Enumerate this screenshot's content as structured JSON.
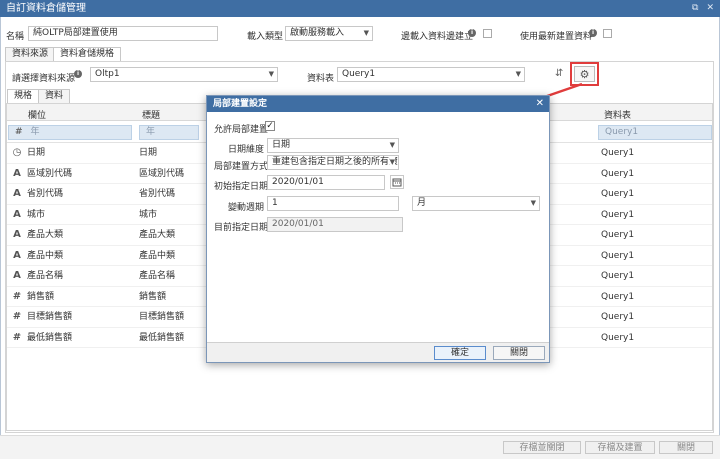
{
  "window": {
    "title": "自訂資料倉儲管理",
    "btn_restore": "⧉",
    "btn_close": "✕"
  },
  "form": {
    "name_label": "名稱",
    "name_value": "純OLTP局部建置使用",
    "load_type_label": "載入類型",
    "load_type_value": "啟動服務載入",
    "rebuild_on_load_label": "邊載入資料邊建立",
    "use_latest_build_label": "使用最新建置資料"
  },
  "top_tabs": [
    "資料來源",
    "資料倉儲規格"
  ],
  "source": {
    "select_source_label": "請選擇資料來源",
    "source_value": "Oltp1",
    "table_label": "資料表",
    "table_value": "Query1"
  },
  "inner_tabs": [
    "規格",
    "資料"
  ],
  "grid": {
    "headers": {
      "field": "欄位",
      "title": "標題",
      "table": "資料表"
    },
    "filter": {
      "field": "年",
      "title": "年",
      "table": "Query1"
    },
    "rows": [
      {
        "icon": "clock",
        "field": "日期",
        "title": "日期",
        "table": "Query1"
      },
      {
        "icon": "text",
        "field": "區域別代碼",
        "title": "區域別代碼",
        "table": "Query1"
      },
      {
        "icon": "text",
        "field": "省別代碼",
        "title": "省別代碼",
        "table": "Query1"
      },
      {
        "icon": "text",
        "field": "城市",
        "title": "城市",
        "table": "Query1"
      },
      {
        "icon": "text",
        "field": "產品大類",
        "title": "產品大類",
        "table": "Query1"
      },
      {
        "icon": "text",
        "field": "產品中類",
        "title": "產品中類",
        "table": "Query1"
      },
      {
        "icon": "text",
        "field": "產品名稱",
        "title": "產品名稱",
        "table": "Query1"
      },
      {
        "icon": "hash",
        "field": "銷售額",
        "title": "銷售額",
        "table": "Query1"
      },
      {
        "icon": "hash",
        "field": "目標銷售額",
        "title": "目標銷售額",
        "table": "Query1"
      },
      {
        "icon": "hash",
        "field": "最低銷售額",
        "title": "最低銷售額",
        "table": "Query1"
      }
    ]
  },
  "footer_buttons": {
    "save_close": "存檔並關閉",
    "save_build": "存檔及建置",
    "close": "關閉"
  },
  "dialog": {
    "title": "局部建置設定",
    "allow_label": "允許局部建置",
    "granularity_label": "日期維度",
    "granularity_value": "日期",
    "method_label": "局部建置方式",
    "method_value": "重建包含指定日期之後的所有資",
    "start_date_label": "初始指定日期",
    "start_date_value": "2020/01/01",
    "period_label": "變動週期",
    "period_value": "1",
    "period_unit": "月",
    "current_date_label": "目前指定日期",
    "current_date_value": "2020/01/01",
    "ok": "確定",
    "close": "關閉"
  },
  "colors": {
    "titlebar": "#3f6ea3",
    "highlight": "#e03c3c"
  }
}
